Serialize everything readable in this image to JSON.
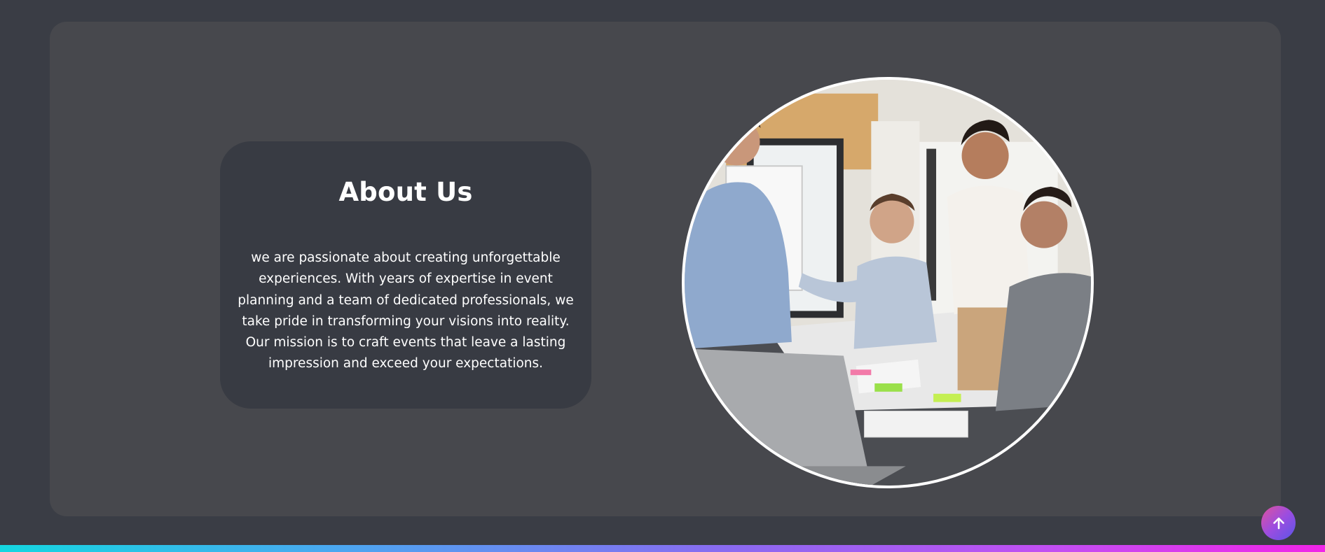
{
  "about": {
    "title": "About Us",
    "text": "we are passionate about creating unforgettable experiences. With years of expertise in event planning and a team of dedicated professionals, we take pride in transforming your visions into reality. Our mission is to craft events that leave a lasting impression and exceed your expectations."
  },
  "photo": {
    "subject": "team meeting around a conference table"
  },
  "scroll_top": {
    "icon": "arrow-up-icon"
  },
  "colors": {
    "page_background": "#3a3d45",
    "section_background": "#47484d",
    "about_box_background": "#383b43",
    "text": "#ffffff",
    "bottom_bar_gradient": [
      "#14d6e0",
      "#8a6af0",
      "#f025e8"
    ]
  }
}
